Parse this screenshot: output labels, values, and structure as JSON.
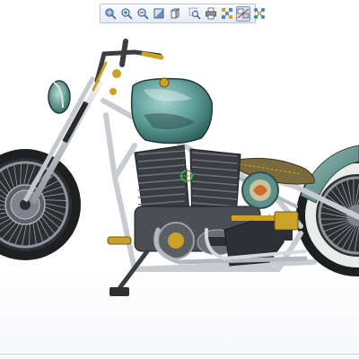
{
  "window": {
    "background": "#ffffff"
  },
  "toolbar": {
    "buttons": [
      {
        "name": "zoom-fit-icon",
        "tooltip": ""
      },
      {
        "name": "zoom-in-icon",
        "tooltip": ""
      },
      {
        "name": "zoom-out-icon",
        "tooltip": ""
      },
      {
        "name": "shaded-view-icon",
        "tooltip": ""
      },
      {
        "name": "view-cube-icon",
        "tooltip": ""
      },
      {
        "name": "zoom-window-icon",
        "tooltip": ""
      },
      {
        "name": "print-icon",
        "tooltip": ""
      },
      {
        "name": "explode-icon",
        "tooltip": ""
      },
      {
        "name": "section-view-icon",
        "tooltip": ""
      },
      {
        "name": "network-icon",
        "tooltip": ""
      }
    ]
  },
  "model": {
    "subject": "motorcycle-cad-model",
    "colors": {
      "tank": "#5f9e9a",
      "fender": "#5f8f8a",
      "frame": "#c8ccd0",
      "engine": "#3a3d42",
      "tire": "#202224",
      "whitewall": "#e9ece9",
      "seat": "#7a6a3e",
      "chrome": "#b4b9bf",
      "accent_yellow": "#c9a227"
    }
  }
}
